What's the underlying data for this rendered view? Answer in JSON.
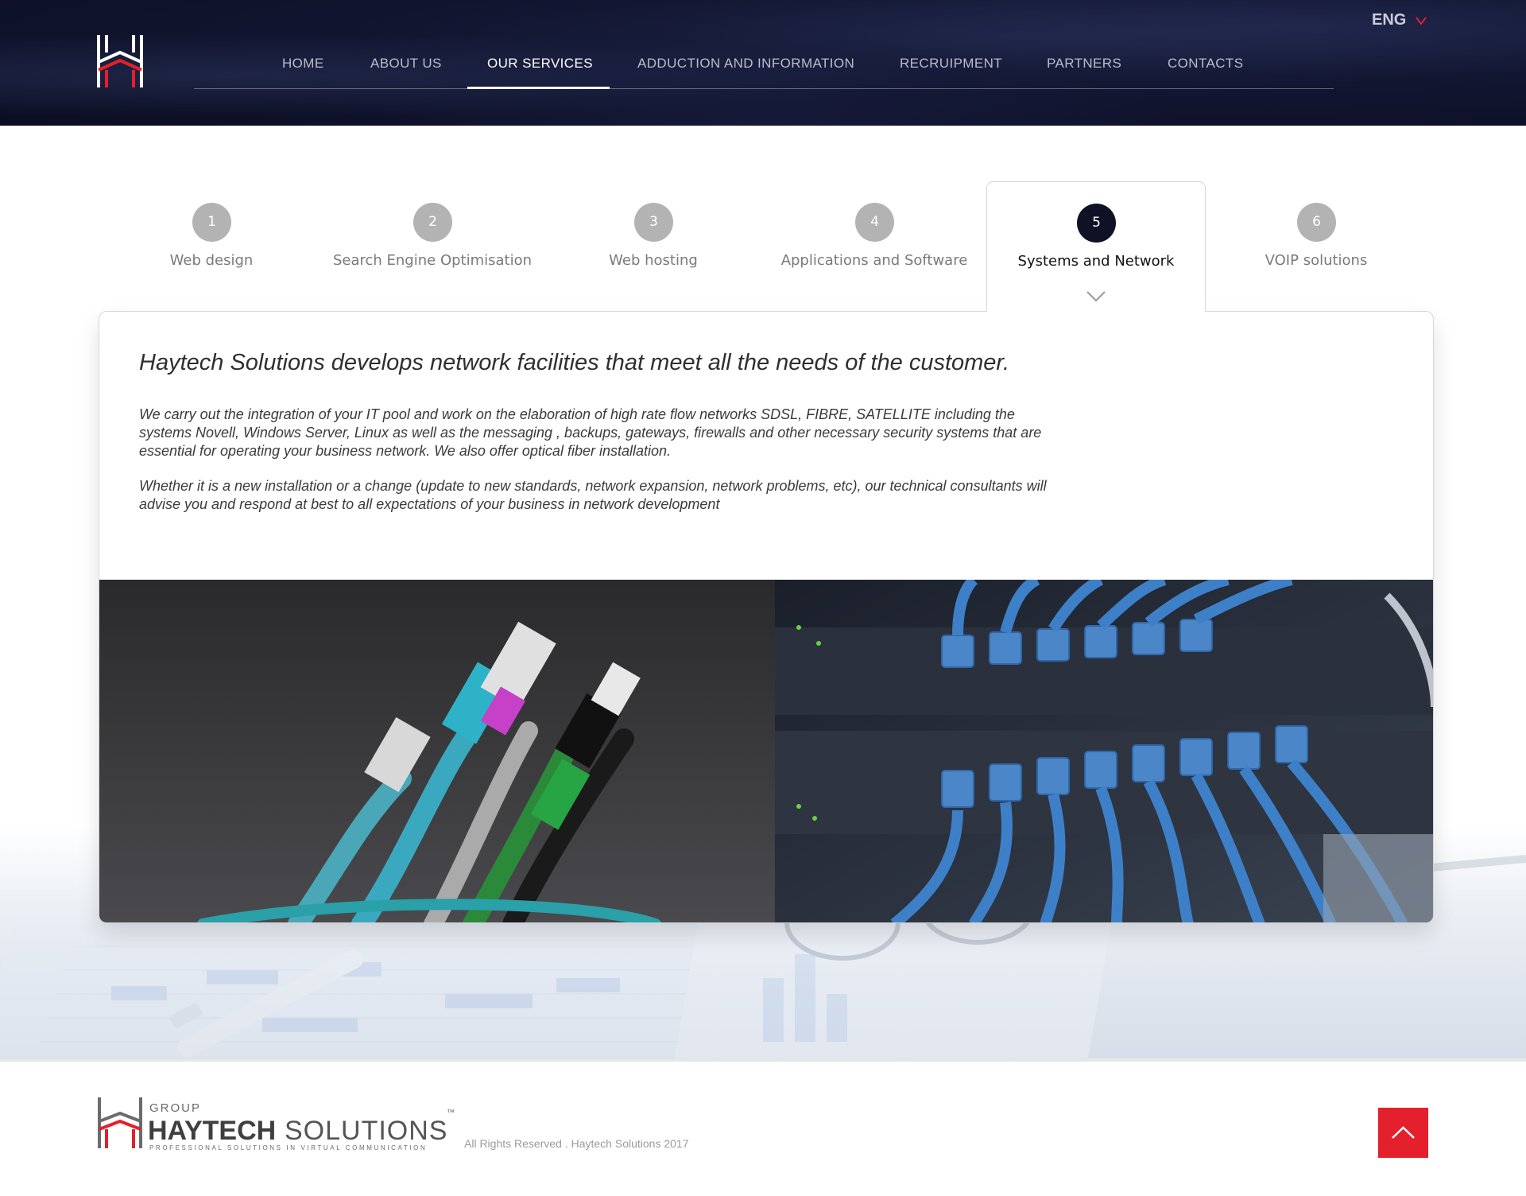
{
  "header": {
    "nav": [
      "HOME",
      "ABOUT US",
      "OUR SERVICES",
      "ADDUCTION AND INFORMATION",
      "RECRUIPMENT",
      "PARTNERS",
      "CONTACTS"
    ],
    "active_nav": "OUR SERVICES",
    "language": "ENG"
  },
  "tabs": [
    {
      "num": "1",
      "label": "Web design"
    },
    {
      "num": "2",
      "label": "Search Engine Optimisation"
    },
    {
      "num": "3",
      "label": "Web hosting"
    },
    {
      "num": "4",
      "label": "Applications and Software"
    },
    {
      "num": "5",
      "label": "Systems and Network"
    },
    {
      "num": "6",
      "label": "VOIP solutions"
    }
  ],
  "active_tab": "5",
  "content": {
    "heading": "Haytech Solutions develops network facilities that meet all the needs of the customer.",
    "paragraph1": "We carry out the integration of your IT pool and work on the elaboration of high rate flow networks SDSL, FIBRE, SATELLITE including the systems Novell, Windows Server, Linux as well as the messaging , backups, gateways, firewalls and other necessary security systems that are essential for operating your business network. We also offer optical fiber installation.",
    "paragraph2": "Whether it is a new installation or a change (update to new standards, network expansion, network problems, etc), our technical consultants will advise you and respond at best to all expectations of your business in network development"
  },
  "footer": {
    "logo_group": "GROUP",
    "logo_haytech": "HAYTECH",
    "logo_solutions": "SOLUTIONS",
    "logo_tm": "™",
    "logo_tagline": "PROFESSIONAL SOLUTIONS IN VIRTUAL COMMUNICATION",
    "rights": "All Rights Reserved . Haytech Solutions 2017"
  },
  "colors": {
    "accent_red": "#e3202b",
    "header_navy": "#111530",
    "active_badge": "#0f1124"
  }
}
